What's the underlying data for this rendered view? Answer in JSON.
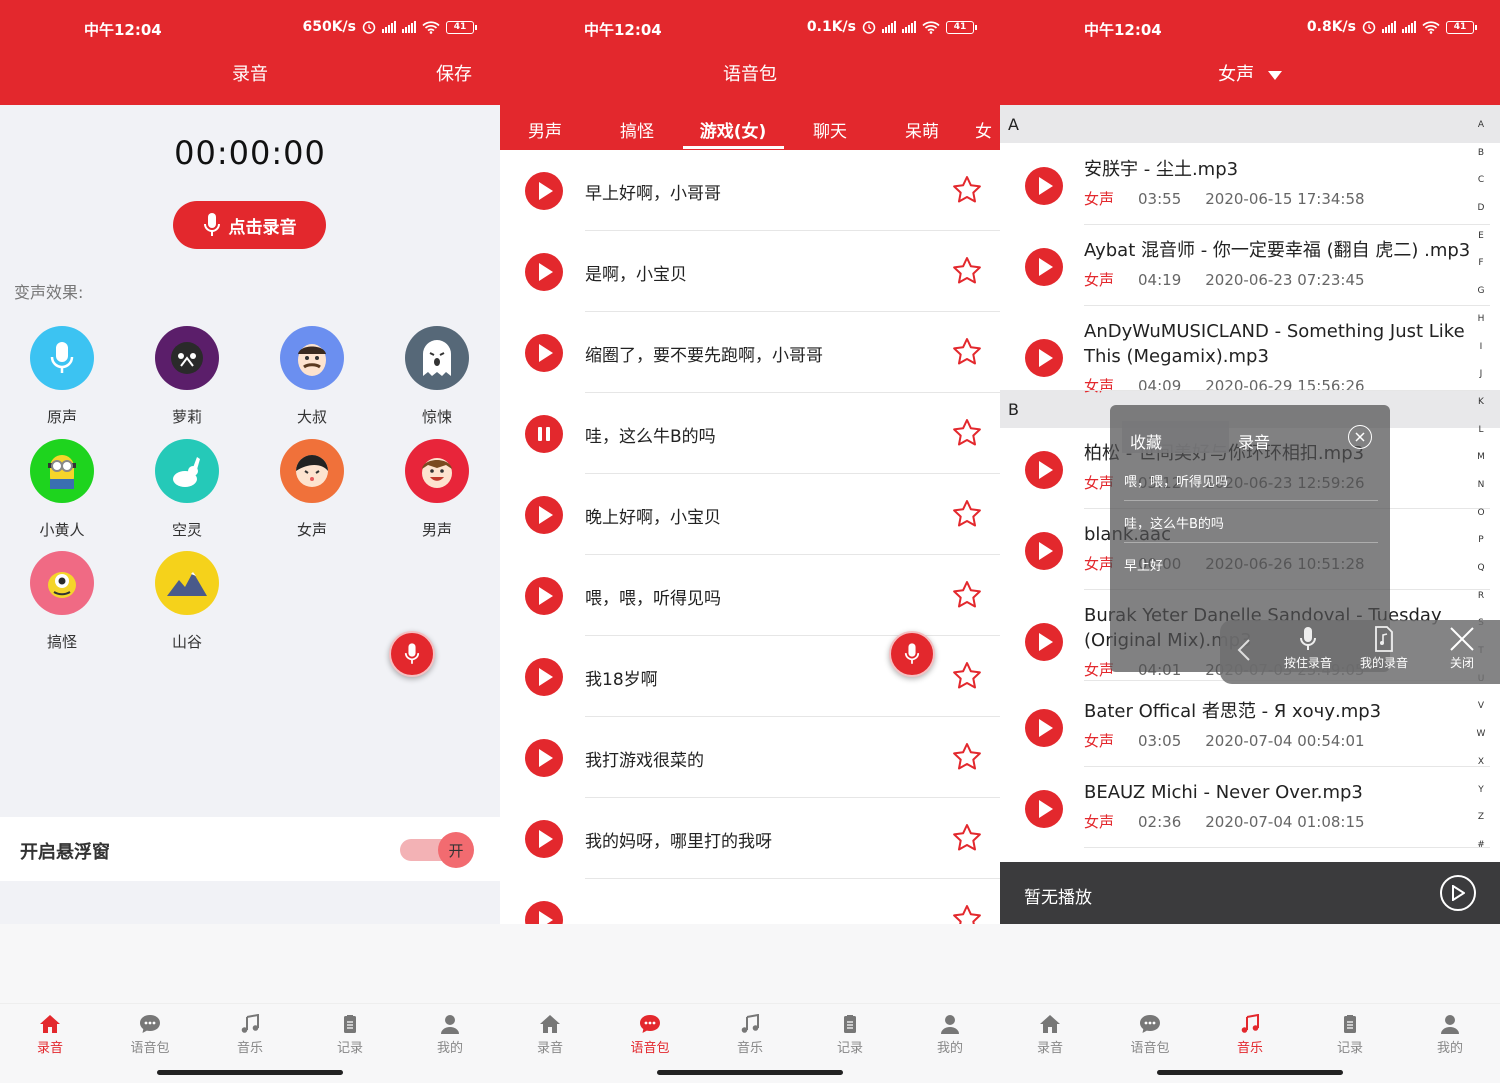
{
  "status": {
    "time": "中午12:04",
    "screen1_speed": "650K/s",
    "screen2_speed": "0.1K/s",
    "screen3_speed": "0.8K/s",
    "battery": "41"
  },
  "colors": {
    "primary": "#e3282d",
    "now_bar": "#3b3b3d"
  },
  "nav": [
    "录音",
    "语音包",
    "音乐",
    "记录",
    "我的"
  ],
  "screen1": {
    "title": "录音",
    "save": "保存",
    "timer": "00:00:00",
    "record_button": "点击录音",
    "effects_label": "变声效果:",
    "effects": [
      "原声",
      "萝莉",
      "大叔",
      "惊悚",
      "小黄人",
      "空灵",
      "女声",
      "男声",
      "搞怪",
      "山谷"
    ],
    "floatwin_label": "开启悬浮窗",
    "toggle_label": "开",
    "toggle_on": true
  },
  "screen2": {
    "title": "语音包",
    "tabs": [
      "男声",
      "搞怪",
      "游戏(女)",
      "聊天",
      "呆萌",
      "女"
    ],
    "active_tab": "游戏(女)",
    "items": [
      "早上好啊，小哥哥",
      "是啊，小宝贝",
      "缩圈了，要不要先跑啊，小哥哥",
      "哇，这么牛B的吗",
      "晚上好啊，小宝贝",
      "喂，喂，听得见吗",
      "我18岁啊",
      "我打游戏很菜的",
      "我的妈呀，哪里打的我呀"
    ],
    "playing_index": 3
  },
  "screen3": {
    "title": "女声",
    "section_a": "A",
    "section_b": "B",
    "songs": [
      {
        "title": "安朕宇 - 尘土.mp3",
        "tag": "女声",
        "duration": "03:55",
        "date": "2020-06-15 17:34:58"
      },
      {
        "title": "Aybat 混音师 - 你一定要幸福 (翻自 虎二) .mp3",
        "tag": "女声",
        "duration": "04:19",
        "date": "2020-06-23 07:23:45"
      },
      {
        "title": "AnDyWuMUSICLAND - Something Just Like This (Megamix).mp3",
        "tag": "女声",
        "duration": "04:09",
        "date": "2020-06-29 15:56:26"
      },
      {
        "title": "柏松 - 世间美好与你环环相扣.mp3",
        "tag": "女声",
        "duration": "03:12",
        "date": "2020-06-23 12:59:26"
      },
      {
        "title": "blank.aac",
        "tag": "女声",
        "duration": "00:00",
        "date": "2020-06-26 10:51:28"
      },
      {
        "title": "Burak Yeter Danelle Sandoval - Tuesday (Original Mix).mp3",
        "tag": "女声",
        "duration": "04:01",
        "date": "2020-07-03 23:49:05"
      },
      {
        "title": "Bater Offical 者思范 - Я хочу.mp3",
        "tag": "女声",
        "duration": "03:05",
        "date": "2020-07-04 00:54:01"
      },
      {
        "title": "BEAUZ Michi - Never Over.mp3",
        "tag": "女声",
        "duration": "02:36",
        "date": "2020-07-04 01:08:15"
      }
    ],
    "index_letters": [
      "A",
      "B",
      "C",
      "D",
      "E",
      "F",
      "G",
      "H",
      "I",
      "J",
      "K",
      "L",
      "M",
      "N",
      "O",
      "P",
      "Q",
      "R",
      "S",
      "T",
      "U",
      "V",
      "W",
      "X",
      "Y",
      "Z",
      "#"
    ],
    "now_playing": "暂无播放",
    "overlay": {
      "tab_favorites": "收藏",
      "tab_recordings": "录音",
      "items": [
        "喂，喂，听得见吗",
        "哇，这么牛B的吗",
        "早上好"
      ],
      "tool_hold": "按住录音",
      "tool_mine": "我的录音",
      "tool_close": "关闭"
    }
  }
}
